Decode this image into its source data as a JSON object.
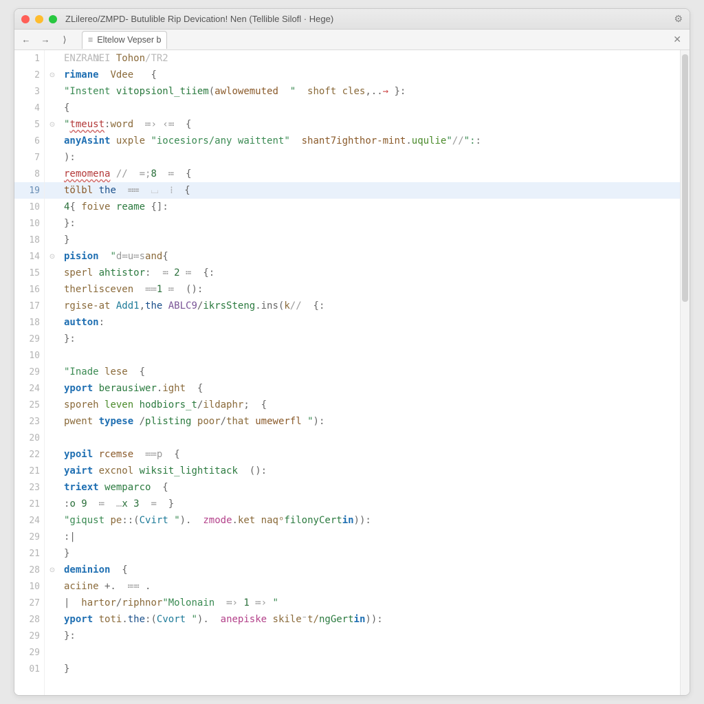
{
  "window": {
    "title": "ZLilereo/ZMPD- Butulible Rip Devication! Nen (Tellible Silofl · Hege)"
  },
  "tab": {
    "label": "Eltelow Vepser b"
  },
  "toolbar": {
    "back": "←",
    "fwd": "→",
    "more": "⟩",
    "close": "✕",
    "gear": "⚙"
  },
  "highlight_index": 8,
  "lines": [
    {
      "num": "1",
      "fold": false,
      "tokens": [
        [
          "dim",
          "ENZRANEI "
        ],
        [
          "ident",
          "Tohon"
        ],
        [
          "dim",
          "/TR2"
        ]
      ],
      "indent": 0,
      "bookmark": true
    },
    {
      "num": "2",
      "fold": true,
      "tokens": [
        [
          "key",
          "rimane"
        ],
        [
          "punc",
          "  "
        ],
        [
          "ident",
          "Vdee"
        ],
        [
          "op",
          "   "
        ],
        [
          "punc",
          "{"
        ]
      ],
      "indent": 1
    },
    {
      "num": "3",
      "fold": false,
      "tokens": [
        [
          "str",
          "\"Instent"
        ],
        [
          "punc",
          " "
        ],
        [
          "func",
          "vitopsionl_tiiem"
        ],
        [
          "punc",
          "("
        ],
        [
          "brown",
          "awlowemuted"
        ],
        [
          "str",
          "  \""
        ],
        [
          "punc",
          "  "
        ],
        [
          "ident",
          "shoft cles"
        ],
        [
          "punc",
          ",.."
        ],
        [
          "arrow",
          "→"
        ],
        [
          "punc",
          " }:"
        ]
      ],
      "indent": 1
    },
    {
      "num": "4",
      "fold": false,
      "tokens": [
        [
          "punc",
          "{"
        ]
      ],
      "indent": 1
    },
    {
      "num": "5",
      "fold": true,
      "tokens": [
        [
          "str",
          "\""
        ],
        [
          "err",
          "tmeust"
        ],
        [
          "punc",
          ":"
        ],
        [
          "ident",
          "word"
        ],
        [
          "op",
          "  ≔› ‹≕  "
        ],
        [
          "punc",
          "{"
        ]
      ],
      "indent": 1
    },
    {
      "num": "6",
      "fold": false,
      "tokens": [
        [
          "key",
          "anyAsint"
        ],
        [
          "punc",
          " "
        ],
        [
          "ident",
          "uxple "
        ],
        [
          "str",
          "\"iocesiors/any waittent\""
        ],
        [
          "punc",
          "  "
        ],
        [
          "brown",
          "shant7ighthor-mint"
        ],
        [
          "punc",
          "."
        ],
        [
          "green2",
          "uqulie"
        ],
        [
          "str",
          "\""
        ],
        [
          "comm",
          "//"
        ],
        [
          "str",
          "\":"
        ],
        [
          "punc",
          ":"
        ]
      ],
      "indent": 2
    },
    {
      "num": "7",
      "fold": false,
      "tokens": [
        [
          "punc",
          "):"
        ]
      ],
      "indent": 1
    },
    {
      "num": "8",
      "fold": false,
      "tokens": [
        [
          "err",
          "remomena"
        ],
        [
          "punc",
          " "
        ],
        [
          "comm",
          "// "
        ],
        [
          "op",
          " =;"
        ],
        [
          "num",
          "8"
        ],
        [
          "op",
          "  ≔  "
        ],
        [
          "punc",
          "{"
        ]
      ],
      "indent": 1
    },
    {
      "num": "19",
      "fold": false,
      "tokens": [
        [
          "brown",
          "tölbl"
        ],
        [
          "punc",
          " "
        ],
        [
          "key2",
          "the"
        ],
        [
          "op",
          "  ≕≔  "
        ],
        [
          "dim",
          "⌴"
        ],
        [
          "op",
          "  ⁞  "
        ],
        [
          "punc",
          "{"
        ]
      ],
      "indent": 2
    },
    {
      "num": "10",
      "fold": false,
      "tokens": [
        [
          "num",
          "4"
        ],
        [
          "punc",
          "{ "
        ],
        [
          "ident",
          "foive"
        ],
        [
          "punc",
          " "
        ],
        [
          "func",
          "reame"
        ],
        [
          "punc",
          " {]:"
        ]
      ],
      "indent": 2
    },
    {
      "num": "10",
      "fold": false,
      "tokens": [
        [
          "punc",
          "}:"
        ]
      ],
      "indent": 1
    },
    {
      "num": "18",
      "fold": false,
      "tokens": [
        [
          "punc",
          "}"
        ]
      ],
      "indent": 0
    },
    {
      "num": "14",
      "fold": true,
      "tokens": [
        [
          "key",
          "pision"
        ],
        [
          "punc",
          "  "
        ],
        [
          "str",
          "\""
        ],
        [
          "op",
          "d≕u≔s"
        ],
        [
          "ident",
          "and"
        ],
        [
          "punc",
          "{"
        ]
      ],
      "indent": 1
    },
    {
      "num": "15",
      "fold": false,
      "tokens": [
        [
          "ident",
          "sperl "
        ],
        [
          "func",
          "ahtistor"
        ],
        [
          "punc",
          ":  "
        ],
        [
          "op",
          "≕ "
        ],
        [
          "num",
          "2"
        ],
        [
          "op",
          " ≔  "
        ],
        [
          "punc",
          "{:"
        ]
      ],
      "indent": 2
    },
    {
      "num": "16",
      "fold": false,
      "tokens": [
        [
          "ident",
          "therlisceven"
        ],
        [
          "op",
          "  ≕≔"
        ],
        [
          "num",
          "1"
        ],
        [
          "op",
          " ≔  "
        ],
        [
          "punc",
          "():"
        ]
      ],
      "indent": 2
    },
    {
      "num": "17",
      "fold": false,
      "tokens": [
        [
          "ident",
          "rgise-at "
        ],
        [
          "type",
          "Add1"
        ],
        [
          "punc",
          ","
        ],
        [
          "key2",
          "the"
        ],
        [
          "punc",
          " "
        ],
        [
          "var",
          "ABLC9"
        ],
        [
          "punc",
          "/"
        ],
        [
          "func",
          "ikrsSteng"
        ],
        [
          "punc",
          ".ins("
        ],
        [
          "ident",
          "k"
        ],
        [
          "comm",
          "//  "
        ],
        [
          "punc",
          "{:"
        ]
      ],
      "indent": 2
    },
    {
      "num": "18",
      "fold": false,
      "tokens": [
        [
          "key",
          "autton"
        ],
        [
          "punc",
          ":"
        ]
      ],
      "indent": 2
    },
    {
      "num": "29",
      "fold": false,
      "tokens": [
        [
          "punc",
          "}:"
        ]
      ],
      "indent": 1
    },
    {
      "num": "10",
      "fold": false,
      "tokens": [],
      "indent": 0
    },
    {
      "num": "29",
      "fold": false,
      "tokens": [
        [
          "str",
          "\"Inade"
        ],
        [
          "punc",
          " "
        ],
        [
          "ident",
          "lese"
        ],
        [
          "punc",
          "  {"
        ]
      ],
      "indent": 1
    },
    {
      "num": "24",
      "fold": false,
      "tokens": [
        [
          "key",
          "yport"
        ],
        [
          "punc",
          " "
        ],
        [
          "func",
          "berausiwer"
        ],
        [
          "punc",
          "."
        ],
        [
          "ident",
          "ight"
        ],
        [
          "punc",
          "  {"
        ]
      ],
      "indent": 2
    },
    {
      "num": "25",
      "fold": false,
      "tokens": [
        [
          "ident",
          "sporeh"
        ],
        [
          "punc",
          " "
        ],
        [
          "green2",
          "leven"
        ],
        [
          "punc",
          " "
        ],
        [
          "func",
          "hodbiors_t"
        ],
        [
          "punc",
          "/"
        ],
        [
          "ident",
          "ildaphr"
        ],
        [
          "punc",
          ";  {"
        ]
      ],
      "indent": 2
    },
    {
      "num": "23",
      "fold": false,
      "tokens": [
        [
          "ident",
          "pwent"
        ],
        [
          "punc",
          " "
        ],
        [
          "key",
          "typese "
        ],
        [
          "punc",
          "/"
        ],
        [
          "func",
          "plisting"
        ],
        [
          "punc",
          " "
        ],
        [
          "ident",
          "poor"
        ],
        [
          "punc",
          "/"
        ],
        [
          "ident",
          "that"
        ],
        [
          "punc",
          " "
        ],
        [
          "brown",
          "umewerfl"
        ],
        [
          "str",
          " \""
        ],
        [
          "punc",
          "):"
        ]
      ],
      "indent": 2
    },
    {
      "num": "20",
      "fold": false,
      "tokens": [],
      "indent": 0
    },
    {
      "num": "22",
      "fold": false,
      "tokens": [
        [
          "key",
          "ypoil"
        ],
        [
          "punc",
          " "
        ],
        [
          "brown",
          "rcemse"
        ],
        [
          "op",
          "  ≕≔p  "
        ],
        [
          "punc",
          "{"
        ]
      ],
      "indent": 2
    },
    {
      "num": "21",
      "fold": false,
      "tokens": [
        [
          "key",
          "yairt"
        ],
        [
          "punc",
          " "
        ],
        [
          "ident",
          "excnol"
        ],
        [
          "punc",
          " "
        ],
        [
          "func",
          "wiksit_lightitack"
        ],
        [
          "punc",
          "  ():"
        ]
      ],
      "indent": 3
    },
    {
      "num": "23",
      "fold": false,
      "tokens": [
        [
          "key",
          "triext"
        ],
        [
          "punc",
          " "
        ],
        [
          "func",
          "wemparco"
        ],
        [
          "punc",
          "  {"
        ]
      ],
      "indent": 4
    },
    {
      "num": "21",
      "fold": false,
      "tokens": [
        [
          "punc",
          ":"
        ],
        [
          "num",
          "o 9"
        ],
        [
          "op",
          "  ≔  "
        ],
        [
          "dim",
          "…"
        ],
        [
          "num",
          "x 3"
        ],
        [
          "op",
          "  ="
        ],
        [
          "punc",
          "  }"
        ]
      ],
      "indent": 5
    },
    {
      "num": "24",
      "fold": false,
      "tokens": [
        [
          "str",
          "\"giqust"
        ],
        [
          "punc",
          " "
        ],
        [
          "ident",
          "pe"
        ],
        [
          "punc",
          "::("
        ],
        [
          "type",
          "Cvirt "
        ],
        [
          "str",
          "\""
        ],
        [
          "punc",
          "). "
        ],
        [
          "pink",
          " zmode"
        ],
        [
          "punc",
          "."
        ],
        [
          "ident",
          "ket"
        ],
        [
          "punc",
          " "
        ],
        [
          "ident",
          "naqᵒ"
        ],
        [
          "func",
          "filonyCert"
        ],
        [
          "key",
          "in"
        ],
        [
          "punc",
          ")):"
        ]
      ],
      "indent": 5
    },
    {
      "num": "29",
      "fold": false,
      "tokens": [
        [
          "punc",
          ":|"
        ]
      ],
      "indent": 5
    },
    {
      "num": "21",
      "fold": false,
      "tokens": [
        [
          "punc",
          "}"
        ]
      ],
      "indent": 4
    },
    {
      "num": "28",
      "fold": true,
      "tokens": [
        [
          "key",
          "deminion"
        ],
        [
          "punc",
          "  {"
        ]
      ],
      "indent": 2
    },
    {
      "num": "10",
      "fold": false,
      "tokens": [
        [
          "ident",
          "aciine"
        ],
        [
          "punc",
          " +. "
        ],
        [
          "op",
          " ≔≕ "
        ],
        [
          "punc",
          "."
        ]
      ],
      "indent": 3
    },
    {
      "num": "27",
      "fold": false,
      "tokens": [
        [
          "punc",
          "|  "
        ],
        [
          "ident",
          "hartor"
        ],
        [
          "punc",
          "/"
        ],
        [
          "ident",
          "riphnor"
        ],
        [
          "str",
          "\"Molonain"
        ],
        [
          "op",
          "  ≕› "
        ],
        [
          "num",
          "1"
        ],
        [
          "op",
          " ≔› "
        ],
        [
          "str",
          "\""
        ]
      ],
      "indent": 4
    },
    {
      "num": "28",
      "fold": false,
      "tokens": [
        [
          "key",
          "yport"
        ],
        [
          "punc",
          " "
        ],
        [
          "ident",
          "toti"
        ],
        [
          "punc",
          "."
        ],
        [
          "key2",
          "the"
        ],
        [
          "punc",
          ":("
        ],
        [
          "type",
          "Cvort "
        ],
        [
          "str",
          "\""
        ],
        [
          "punc",
          "). "
        ],
        [
          "pink",
          " anepiske"
        ],
        [
          "punc",
          " "
        ],
        [
          "ident",
          "skile"
        ],
        [
          "punc",
          "⁻"
        ],
        [
          "ident",
          "t/"
        ],
        [
          "func",
          "ngGert"
        ],
        [
          "key",
          "in"
        ],
        [
          "punc",
          ")):"
        ]
      ],
      "indent": 3
    },
    {
      "num": "29",
      "fold": false,
      "tokens": [
        [
          "punc",
          "}:"
        ]
      ],
      "indent": 2
    },
    {
      "num": "29",
      "fold": false,
      "tokens": [],
      "indent": 0
    },
    {
      "num": "01",
      "fold": false,
      "tokens": [
        [
          "punc",
          "}"
        ],
        [
          "punc",
          ""
        ]
      ],
      "indent": 1
    }
  ]
}
